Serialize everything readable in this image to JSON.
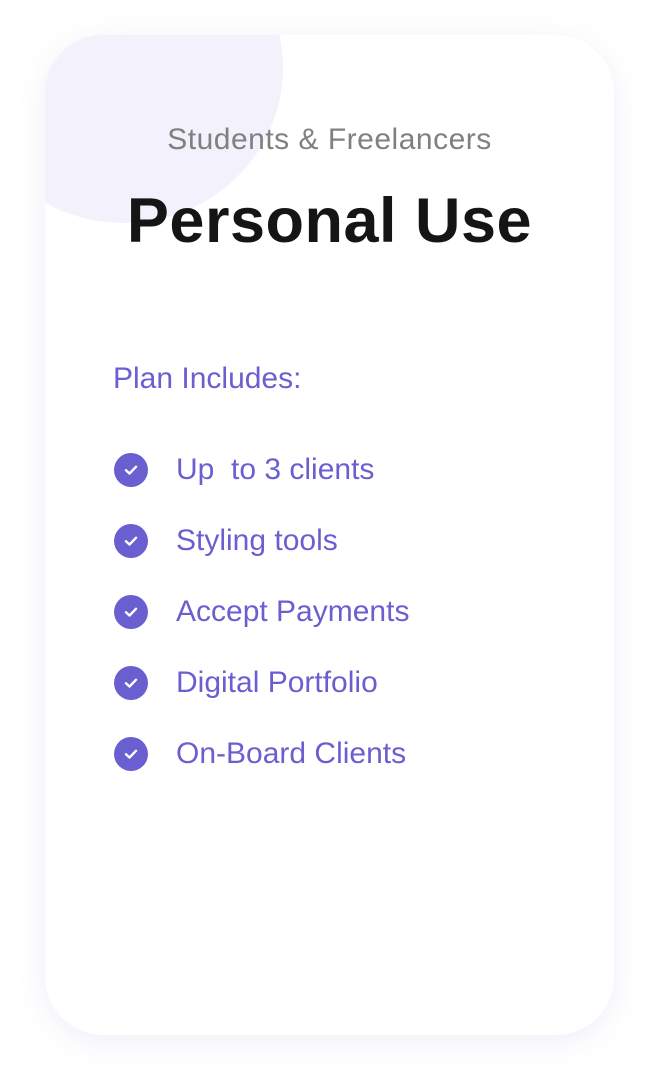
{
  "plan": {
    "subtitle": "Students & Freelancers",
    "title": "Personal Use",
    "includes_label": "Plan Includes:",
    "features": [
      {
        "label": "Up  to 3 clients",
        "icon": "check-circle-icon"
      },
      {
        "label": "Styling tools",
        "icon": "check-circle-icon"
      },
      {
        "label": "Accept Payments",
        "icon": "check-circle-icon"
      },
      {
        "label": "Digital Portfolio",
        "icon": "check-circle-icon"
      },
      {
        "label": "On-Board Clients",
        "icon": "check-circle-icon"
      }
    ]
  },
  "colors": {
    "accent": "#6a5fd0",
    "title": "#151515",
    "subtitle": "#808080",
    "decor": "#f3f1fc"
  }
}
